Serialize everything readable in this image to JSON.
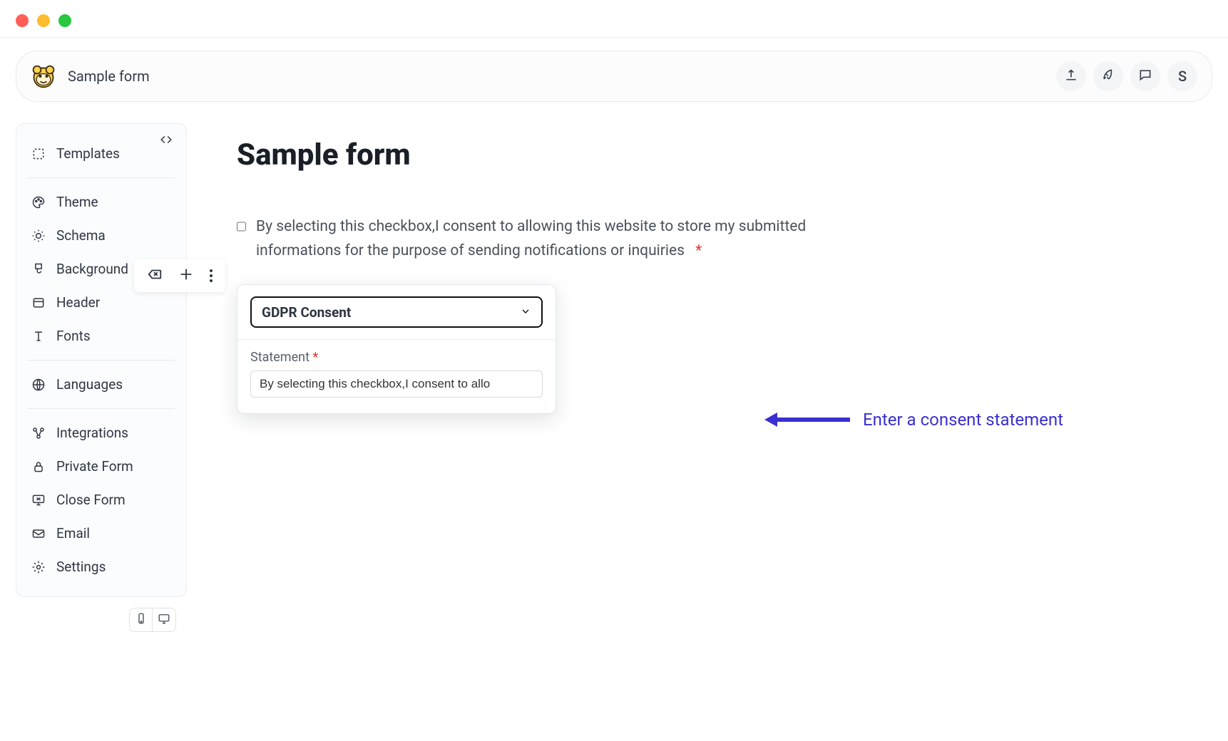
{
  "topbar": {
    "title": "Sample form",
    "avatar_initial": "S"
  },
  "sidebar": {
    "items": [
      {
        "label": "Templates"
      },
      {
        "label": "Theme"
      },
      {
        "label": "Schema"
      },
      {
        "label": "Background"
      },
      {
        "label": "Header"
      },
      {
        "label": "Fonts"
      },
      {
        "label": "Languages"
      },
      {
        "label": "Integrations"
      },
      {
        "label": "Private Form"
      },
      {
        "label": "Close Form"
      },
      {
        "label": "Email"
      },
      {
        "label": "Settings"
      }
    ]
  },
  "canvas": {
    "form_title": "Sample form",
    "consent_text": "By selecting this checkbox,I consent to allowing this website to store my submitted informations for the purpose of sending notifications or inquiries",
    "required_mark": "*"
  },
  "editor": {
    "type_select_value": "GDPR Consent",
    "statement_label": "Statement",
    "statement_required": "*",
    "statement_value": "By selecting this checkbox,I consent to allo"
  },
  "annotation": {
    "text": "Enter a consent statement"
  }
}
